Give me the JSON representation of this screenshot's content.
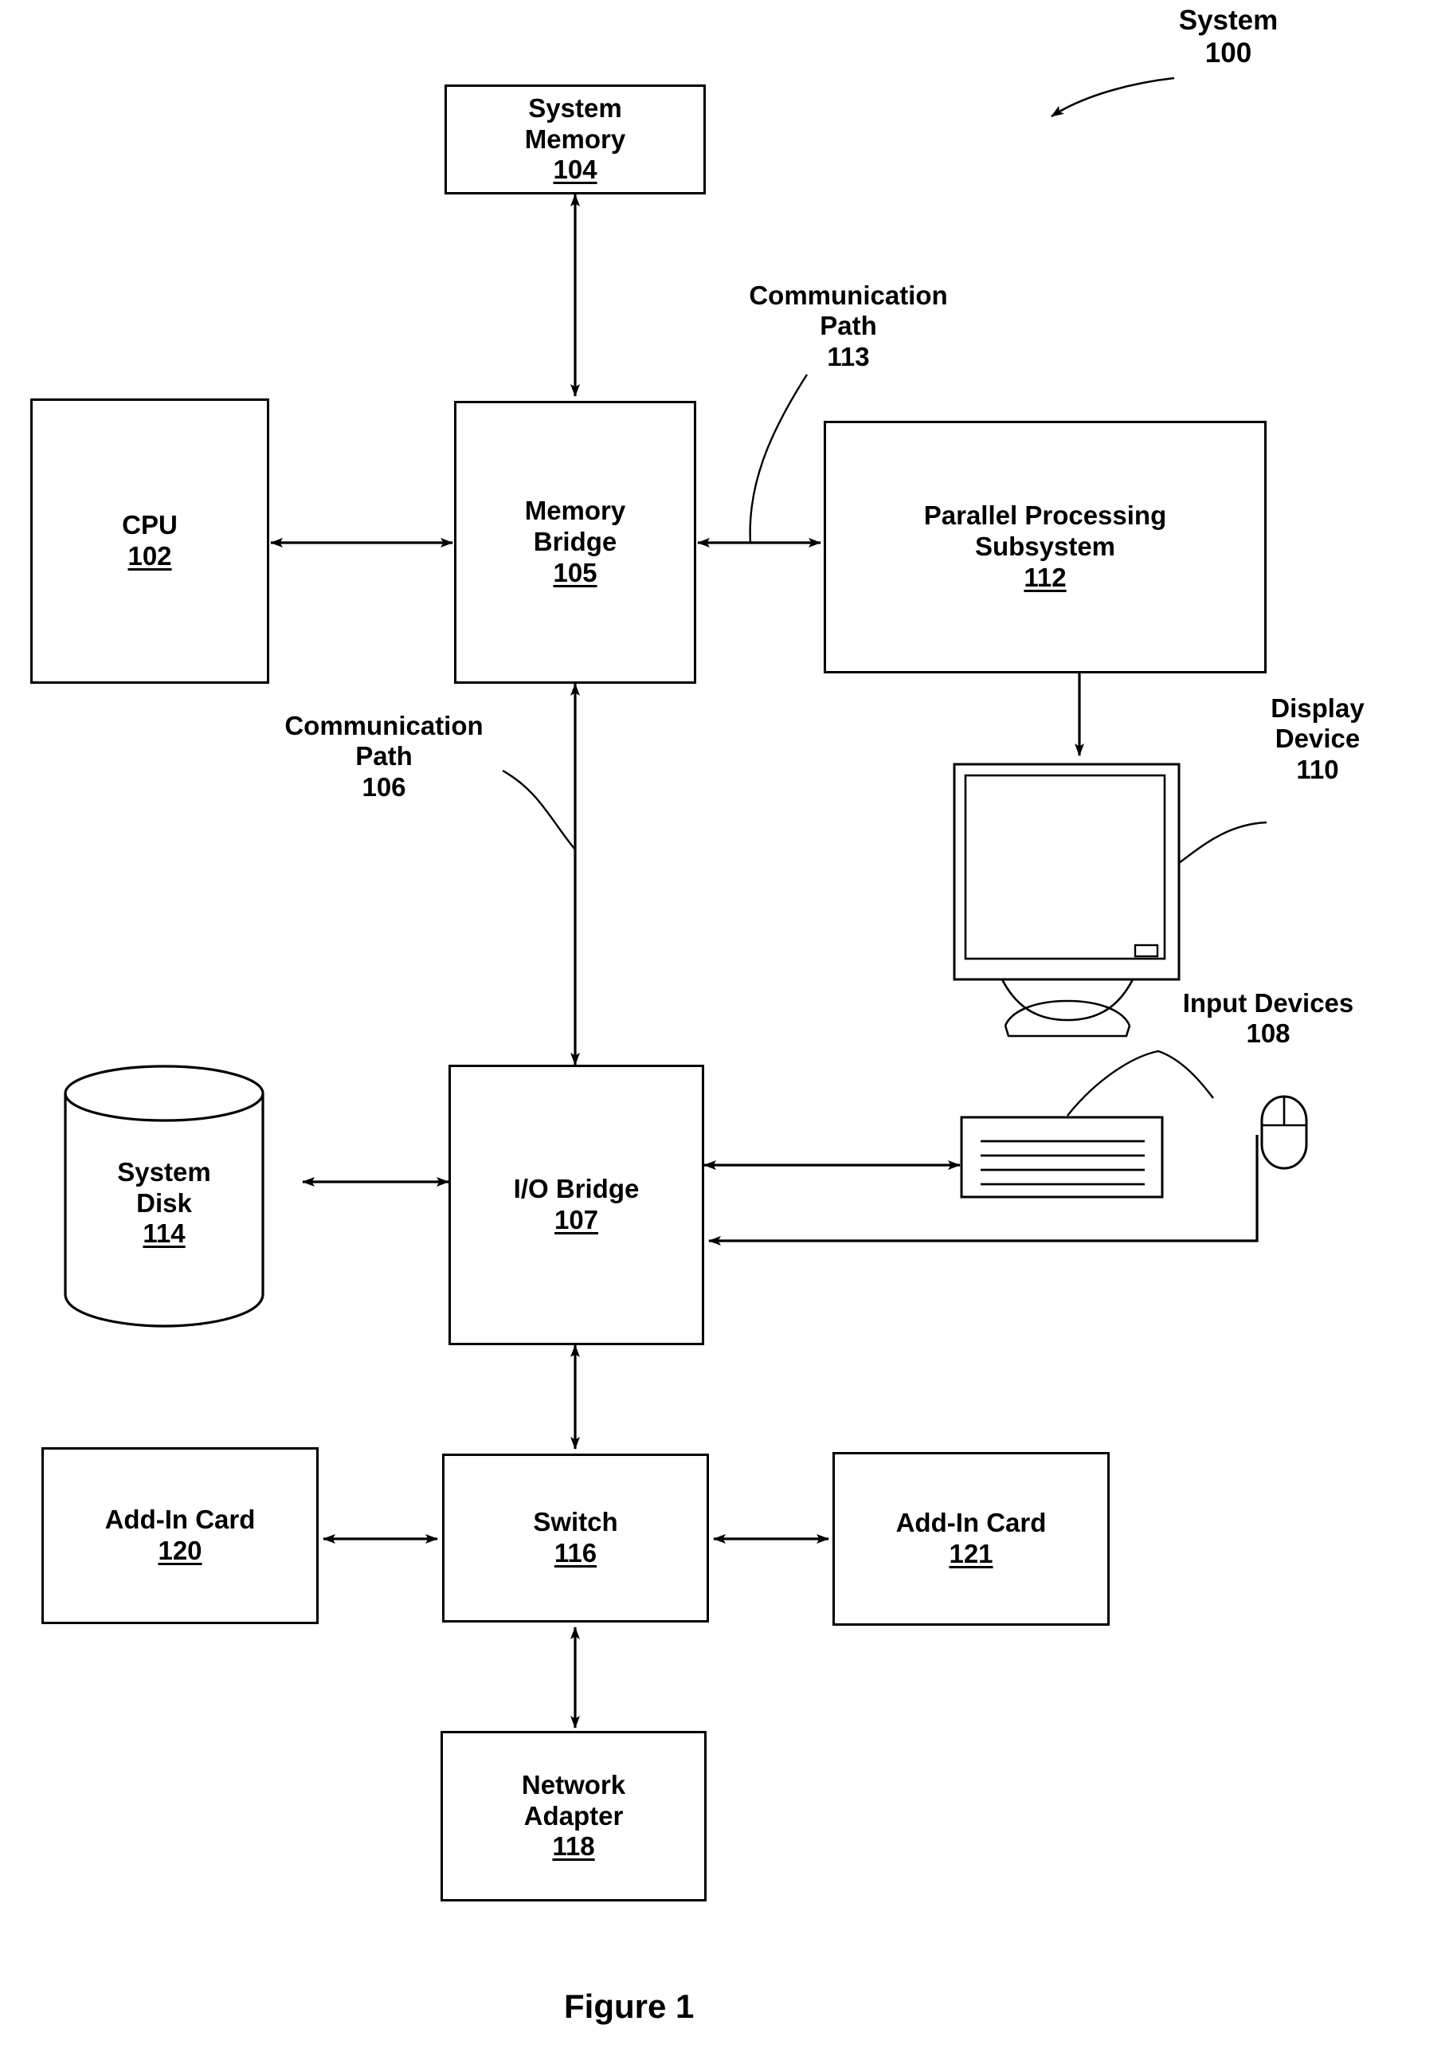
{
  "figure": {
    "caption": "Figure 1",
    "system_label": {
      "line1": "System",
      "line2": "100"
    }
  },
  "nodes": [
    {
      "id": "system_memory",
      "line1": "System",
      "line2": "Memory",
      "ref": "104"
    },
    {
      "id": "cpu",
      "line1": "CPU",
      "line2": "",
      "ref": "102"
    },
    {
      "id": "memory_bridge",
      "line1": "Memory",
      "line2": "Bridge",
      "ref": "105"
    },
    {
      "id": "parallel_processing_subsystem",
      "line1": "Parallel Processing",
      "line2": "Subsystem",
      "ref": "112"
    },
    {
      "id": "system_disk",
      "line1": "System",
      "line2": "Disk",
      "ref": "114"
    },
    {
      "id": "io_bridge",
      "line1": "I/O Bridge",
      "line2": "",
      "ref": "107"
    },
    {
      "id": "add_in_card_120",
      "line1": "Add-In Card",
      "line2": "",
      "ref": "120"
    },
    {
      "id": "switch",
      "line1": "Switch",
      "line2": "",
      "ref": "116"
    },
    {
      "id": "add_in_card_121",
      "line1": "Add-In Card",
      "line2": "",
      "ref": "121"
    },
    {
      "id": "network_adapter",
      "line1": "Network",
      "line2": "Adapter",
      "ref": "118"
    }
  ],
  "callouts": {
    "comm_path_113": {
      "line1": "Communication",
      "line2": "Path",
      "line3": "113"
    },
    "comm_path_106": {
      "line1": "Communication",
      "line2": "Path",
      "line3": "106"
    },
    "display_device": {
      "line1": "Display",
      "line2": "Device",
      "line3": "110"
    },
    "input_devices": {
      "line1": "Input Devices",
      "line2": "108"
    }
  },
  "icons": {
    "monitor": "display-monitor-icon",
    "keyboard": "keyboard-icon",
    "mouse": "mouse-icon",
    "disk_cylinder": "disk-cylinder-icon"
  },
  "colors": {
    "ink": "#000000",
    "paper": "#ffffff"
  }
}
